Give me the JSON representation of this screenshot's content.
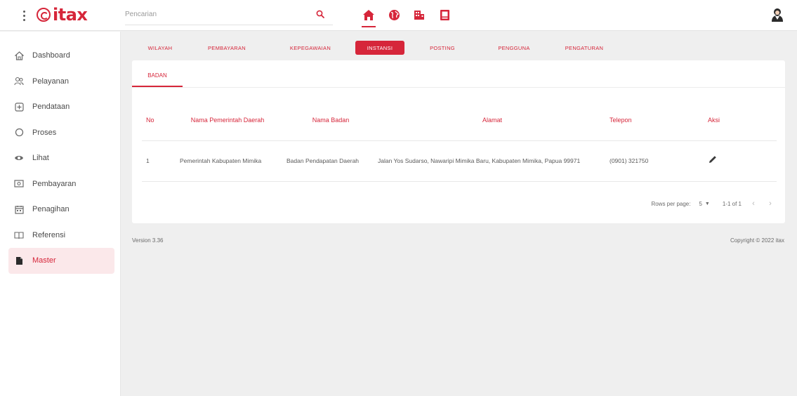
{
  "app": {
    "logo_text": "itax",
    "brand_color": "#d6263a"
  },
  "search": {
    "placeholder": "Pencarian"
  },
  "topnav": [
    {
      "icon": "home-icon",
      "active": true
    },
    {
      "icon": "globe-icon",
      "active": false
    },
    {
      "icon": "building-icon",
      "active": false
    },
    {
      "icon": "document-icon",
      "active": false
    }
  ],
  "sidebar": {
    "items": [
      {
        "label": "Dashboard",
        "icon": "home-outline-icon"
      },
      {
        "label": "Pelayanan",
        "icon": "users-icon"
      },
      {
        "label": "Pendataan",
        "icon": "plus-box-icon"
      },
      {
        "label": "Proses",
        "icon": "circle-icon"
      },
      {
        "label": "Lihat",
        "icon": "eye-icon"
      },
      {
        "label": "Pembayaran",
        "icon": "cash-icon"
      },
      {
        "label": "Penagihan",
        "icon": "calendar-icon"
      },
      {
        "label": "Referensi",
        "icon": "book-icon"
      },
      {
        "label": "Master",
        "icon": "file-icon",
        "active": true
      }
    ]
  },
  "tabs": [
    {
      "label": "WILAYAH"
    },
    {
      "label": "PEMBAYARAN"
    },
    {
      "label": "KEPEGAWAIAN"
    },
    {
      "label": "INSTANSI",
      "active": true
    },
    {
      "label": "POSTING"
    },
    {
      "label": "PENGGUNA"
    },
    {
      "label": "PENGATURAN"
    }
  ],
  "subtab": {
    "label": "BADAN"
  },
  "table": {
    "headers": {
      "no": "No",
      "pemda": "Nama Pemerintah Daerah",
      "badan": "Nama Badan",
      "alamat": "Alamat",
      "telepon": "Telepon",
      "aksi": "Aksi"
    },
    "rows": [
      {
        "no": "1",
        "pemda": "Pemerintah Kabupaten Mimika",
        "badan": "Badan Pendapatan Daerah",
        "alamat": "Jalan Yos Sudarso, Nawaripi Mimika Baru, Kabupaten Mimika, Papua 99971",
        "telepon": "(0901) 321750"
      }
    ]
  },
  "pagination": {
    "rows_per_page_label": "Rows per page:",
    "rows_per_page_value": "5",
    "range": "1-1 of 1"
  },
  "footer": {
    "version": "Version 3.36",
    "copyright": "Copyright © 2022 itax"
  }
}
